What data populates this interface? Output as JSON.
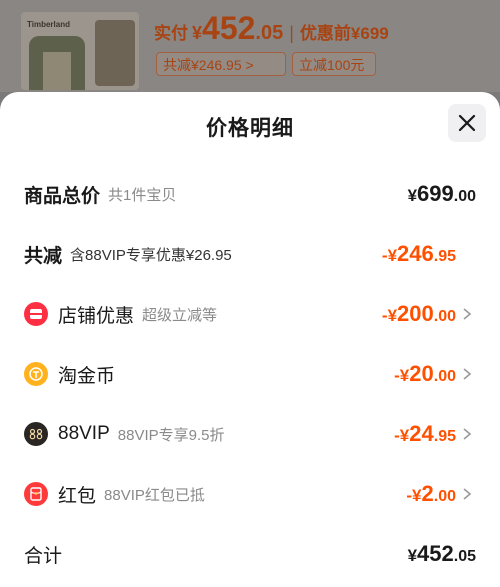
{
  "product": {
    "thumb_brand": "Timberland",
    "paid_label": "实付",
    "yen": "¥",
    "paid_int": "452",
    "paid_dec": ".05",
    "separator": "|",
    "original_label": "优惠前¥699",
    "tag_saved": "共减¥246.95 >",
    "tag_coupon": "立减100元"
  },
  "sheet": {
    "title": "价格明细",
    "rows": [
      {
        "label": "商品总价",
        "sub": "共1件宝贝",
        "sign": "¥",
        "int": "699",
        "dec": ".00"
      },
      {
        "label": "共减",
        "sub": "含88VIP专享优惠¥26.95",
        "sign": "-¥",
        "int": "246",
        "dec": ".95"
      },
      {
        "label": "店铺优惠",
        "sub": "超级立减等",
        "sign": "-¥",
        "int": "200",
        "dec": ".00",
        "icon": "shop-coupon-icon"
      },
      {
        "label": "淘金币",
        "sub": "",
        "sign": "-¥",
        "int": "20",
        "dec": ".00",
        "icon": "gold-coin-icon"
      },
      {
        "label": "88VIP",
        "sub": "88VIP专享9.5折",
        "sign": "-¥",
        "int": "24",
        "dec": ".95",
        "icon": "vip-88-icon"
      },
      {
        "label": "红包",
        "sub": "88VIP红包已抵",
        "sign": "-¥",
        "int": "2",
        "dec": ".00",
        "icon": "red-packet-icon"
      },
      {
        "label": "合计",
        "sub": "",
        "sign": "¥",
        "int": "452",
        "dec": ".05"
      }
    ]
  },
  "colors": {
    "accent": "#ff5000",
    "text": "#1a1a1a",
    "muted": "#8a8a8a"
  }
}
